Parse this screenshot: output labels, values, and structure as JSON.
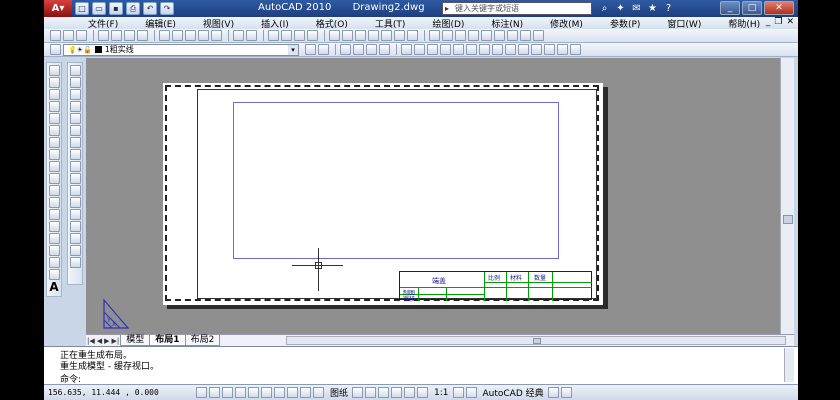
{
  "title": {
    "app": "AutoCAD 2010",
    "document": "Drawing2.dwg",
    "help_search_placeholder": "键入关键字或短语"
  },
  "menu": [
    "文件(F)",
    "编辑(E)",
    "视图(V)",
    "插入(I)",
    "格式(O)",
    "工具(T)",
    "绘图(D)",
    "标注(N)",
    "修改(M)",
    "参数(P)",
    "窗口(W)",
    "帮助(H)"
  ],
  "layers": {
    "current": "1粗实线"
  },
  "drawing": {
    "titleblock": {
      "title": "端盖",
      "col1": "比例",
      "col2": "材料",
      "col3": "数量",
      "row1": "制图",
      "row2": "审核"
    }
  },
  "tabs": {
    "model": "模型",
    "layout1": "布局1",
    "layout2": "布局2",
    "active": "layout1"
  },
  "command": {
    "line1": "正在重生成布局。",
    "line2": "重生成模型 - 缓存视口。",
    "prompt": "命令:"
  },
  "status": {
    "coords": "156.635, 11.444 , 0.000",
    "paper": "图纸",
    "annotation_scale": "1:1",
    "workspace": "AutoCAD 经典"
  },
  "colors": {
    "titlebar": "#2e5aa4",
    "background": "#8f8f8f",
    "viewport_border": "#6b6bd0",
    "titleblock_lines": "#00a000"
  }
}
